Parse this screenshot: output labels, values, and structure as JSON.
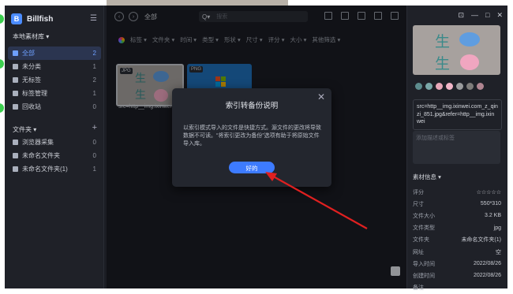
{
  "app": {
    "name": "Billfish"
  },
  "sidebar": {
    "library_title": "本地素材库 ▾",
    "items": [
      {
        "label": "全部",
        "count": "2"
      },
      {
        "label": "未分类",
        "count": "1"
      },
      {
        "label": "无标签",
        "count": "2"
      },
      {
        "label": "标签管理",
        "count": "1"
      },
      {
        "label": "回收站",
        "count": "0"
      }
    ],
    "folders_title": "文件夹 ▾",
    "folders": [
      {
        "label": "浏览器采集",
        "count": "0"
      },
      {
        "label": "未命名文件夹",
        "count": "0"
      },
      {
        "label": "未命名文件夹(1)",
        "count": "1"
      }
    ]
  },
  "toolbar": {
    "breadcrumb": "全部",
    "search_placeholder": "搜索"
  },
  "filters": [
    "标签 ▾",
    "文件夹 ▾",
    "时间 ▾",
    "类型 ▾",
    "形状 ▾",
    "尺寸 ▾",
    "评分 ▾",
    "大小 ▾",
    "其他筛选 ▾"
  ],
  "thumbs": [
    {
      "tag": "JPG",
      "caption": "src=http__img.ixinwei"
    },
    {
      "tag": "PNG",
      "caption": ""
    }
  ],
  "dialog": {
    "title": "索引转备份说明",
    "body": "以索引模式导入的文件是快捷方式。源文件的更改将导致数据不可读。“将索引更改为备份”选项有助于将原始文件导入库。",
    "ok_label": "好的"
  },
  "panel": {
    "swatches": [
      "#5d8c8e",
      "#7aa7a8",
      "#e8a7b9",
      "#f2b5c8",
      "#9a9b9d",
      "#7e7c7a",
      "#b08591"
    ],
    "source": "src=http__img.ixinwei.com_z_qinzi_851.jpg&refer=http__img.ixinwei",
    "note_placeholder": "添加描述或标签",
    "meta_title": "素材信息 ▾",
    "meta": [
      {
        "k": "评分",
        "v": "☆☆☆☆☆"
      },
      {
        "k": "尺寸",
        "v": "550*310"
      },
      {
        "k": "文件大小",
        "v": "3.2 KB"
      },
      {
        "k": "文件类型",
        "v": "jpg"
      },
      {
        "k": "文件夹",
        "v": "未命名文件夹(1)"
      },
      {
        "k": "网址",
        "v": "空"
      },
      {
        "k": "导入时间",
        "v": "2022/08/26"
      },
      {
        "k": "创建时间",
        "v": "2022/08/26"
      },
      {
        "k": "备注",
        "v": ""
      }
    ]
  },
  "colors": {
    "accent": "#3d7bff",
    "arrow": "#e02020",
    "bg": "#1b1d24"
  }
}
